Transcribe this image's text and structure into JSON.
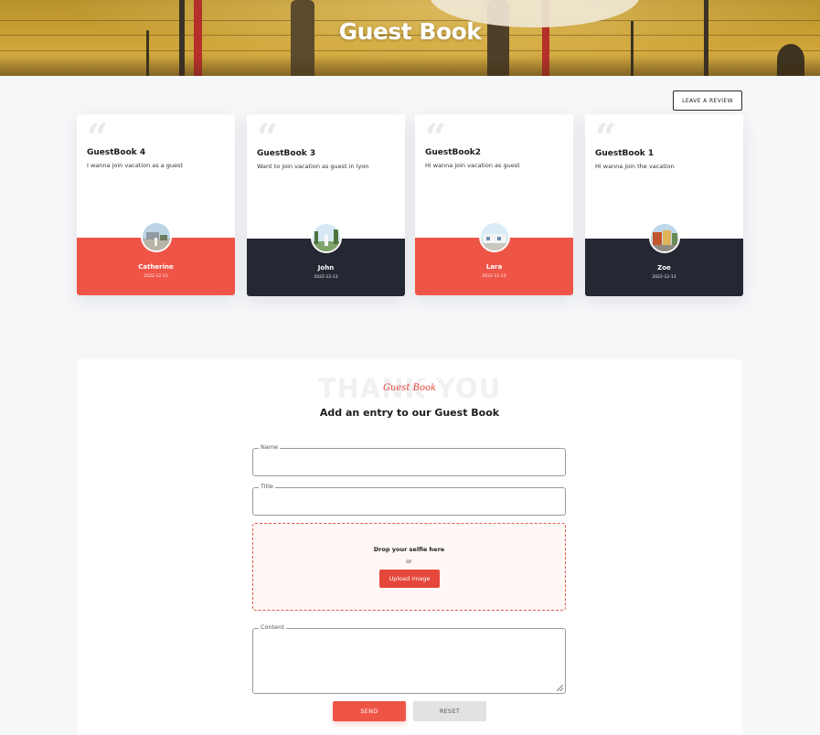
{
  "hero": {
    "title": "Guest Book"
  },
  "actions": {
    "leave_review": "LEAVE A REVIEW"
  },
  "entries": [
    {
      "title": "GuestBook 4",
      "text": "I wanna join vacation as a guest",
      "name": "Catherine",
      "date": "2022-12-13",
      "band_color": "#ef5547"
    },
    {
      "title": "GuestBook 3",
      "text": "Want to join vacation as guest in lyon",
      "name": "John",
      "date": "2022-12-13",
      "band_color": "#232833"
    },
    {
      "title": "GuestBook2",
      "text": "Hi wanna join vacation as guest",
      "name": "Lara",
      "date": "2022-12-13",
      "band_color": "#ef5547"
    },
    {
      "title": "GuestBook 1",
      "text": "Hi wanna join the vacation",
      "name": "Zoe",
      "date": "2022-12-13",
      "band_color": "#232833"
    }
  ],
  "form": {
    "ghost_text": "THANK YOU",
    "script_label": "Guest Book",
    "heading": "Add an entry to our Guest Book",
    "name_label": "Name",
    "title_label": "Title",
    "dropzone_title": "Drop your selfie here",
    "dropzone_or": "or",
    "upload_label": "Upload image",
    "content_label": "Content",
    "send_label": "SEND",
    "reset_label": "RESET"
  },
  "colors": {
    "accent": "#ef5547",
    "dark": "#232833"
  }
}
